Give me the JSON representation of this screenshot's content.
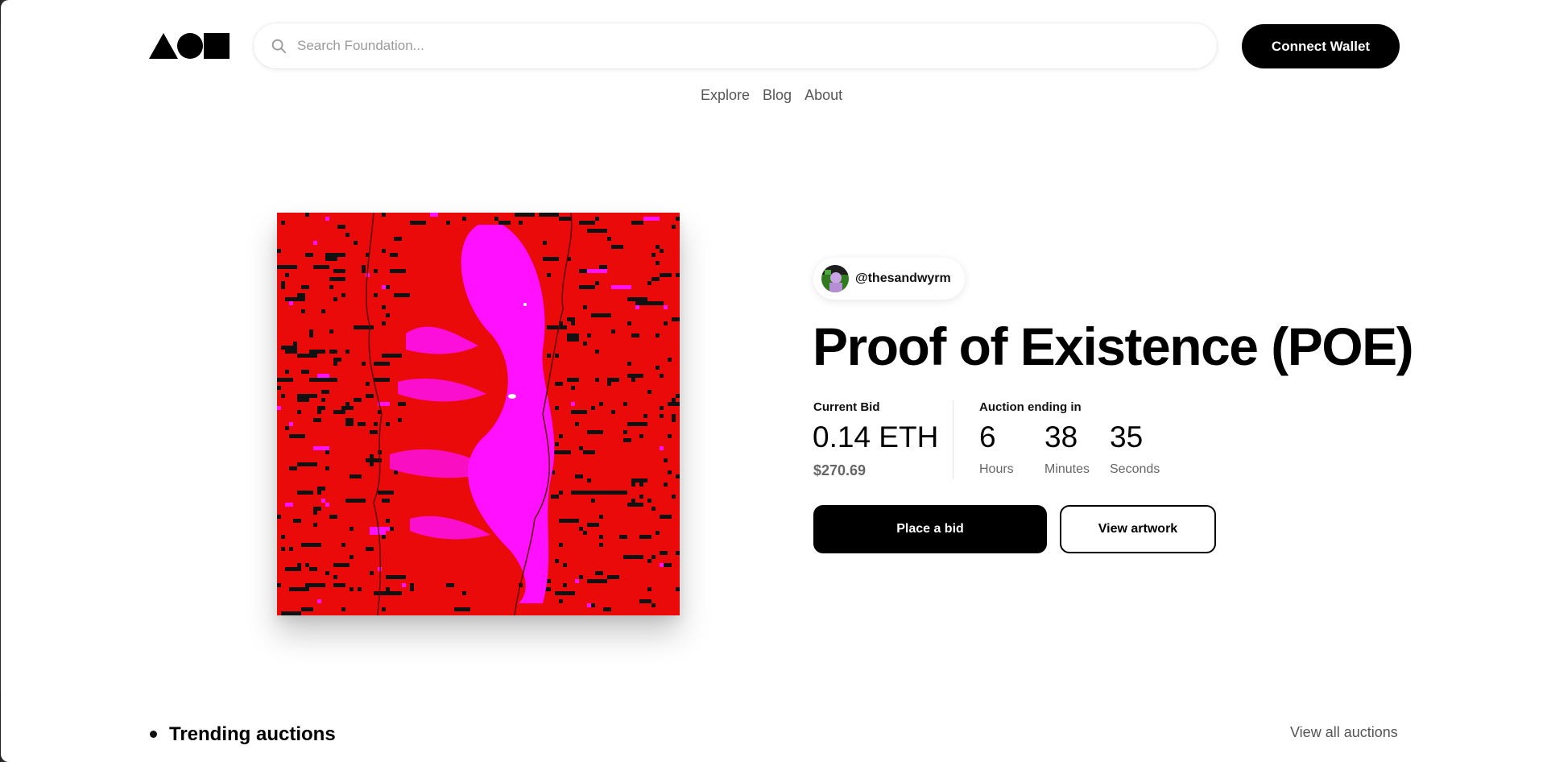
{
  "header": {
    "logo_name": "Foundation",
    "search_placeholder": "Search Foundation...",
    "connect_label": "Connect Wallet"
  },
  "nav": [
    "Explore",
    "Blog",
    "About"
  ],
  "feature": {
    "creator_handle": "@thesandwyrm",
    "title": "Proof of Existence (POE)",
    "current_bid_label": "Current Bid",
    "current_bid_amount": "0.14 ETH",
    "current_bid_usd": "$270.69",
    "auction_label": "Auction ending in",
    "countdown": [
      {
        "value": "6",
        "unit": "Hours"
      },
      {
        "value": "38",
        "unit": "Minutes"
      },
      {
        "value": "35",
        "unit": "Seconds"
      }
    ],
    "place_bid_label": "Place a bid",
    "view_artwork_label": "View artwork"
  },
  "trending": {
    "title": "Trending auctions",
    "view_all_label": "View all auctions"
  },
  "colors": {
    "art_red": "#ea0a0a",
    "art_magenta": "#ff10ff",
    "accent": "#000000"
  }
}
